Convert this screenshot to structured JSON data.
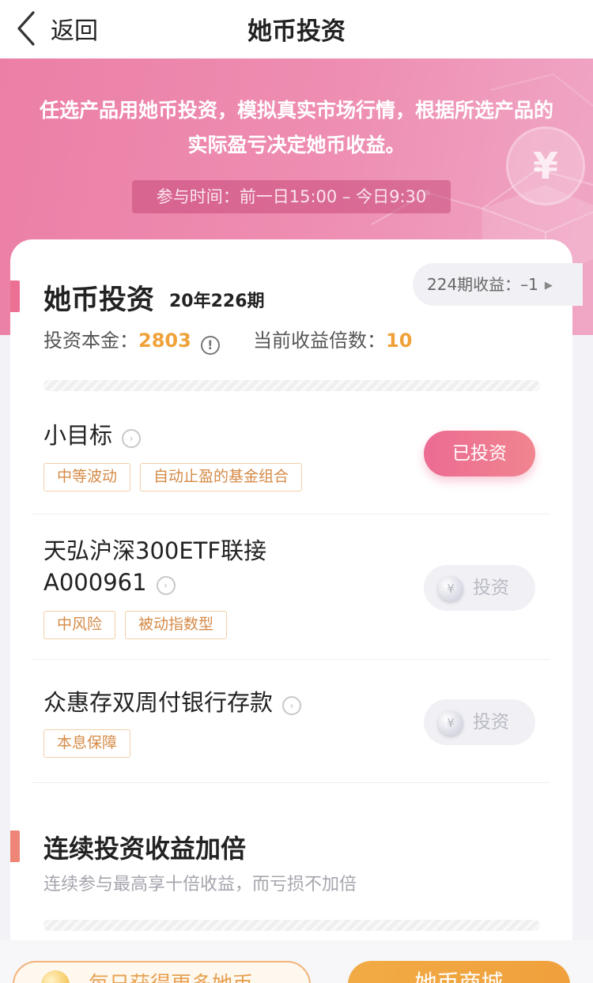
{
  "nav": {
    "back_label": "返回",
    "title": "她币投资"
  },
  "banner": {
    "description": "任选产品用她币投资，模拟真实市场行情，根据所选产品的实际盈亏决定她币收益。",
    "time_range": "参与时间：前一日15:00 – 今日9:30",
    "coin_glyph": "¥"
  },
  "card": {
    "title": "她币投资",
    "period": "20年226期",
    "prev_earnings_label": "224期收益：–1",
    "principal_label": "投资本金：",
    "principal_value": "2803",
    "multiplier_label": "当前收益倍数：",
    "multiplier_value": "10",
    "info_glyph": "!",
    "arrow_glyph": "›"
  },
  "products": [
    {
      "name": "小目标",
      "tags": [
        "中等波动",
        "自动止盈的基金组合"
      ],
      "button_label": "已投资",
      "invested": true
    },
    {
      "name_line1": "天弘沪深300ETF联接",
      "name_line2": "A000961",
      "tags": [
        "中风险",
        "被动指数型"
      ],
      "button_label": "投资",
      "invested": false
    },
    {
      "name": "众惠存双周付银行存款",
      "tags": [
        "本息保障"
      ],
      "button_label": "投资",
      "invested": false
    }
  ],
  "double_section": {
    "title": "连续投资收益加倍",
    "subtitle": "连续参与最高享十倍收益，而亏损不加倍"
  },
  "bottom": {
    "earn_label": "每日获得更多她币",
    "mall_label": "她币商城"
  },
  "colors": {
    "brand_pink": "#ec6b93",
    "accent_orange": "#f0a23a",
    "section_bar_pink": "#ec6f94",
    "section_bar_salmon": "#ee8577"
  }
}
